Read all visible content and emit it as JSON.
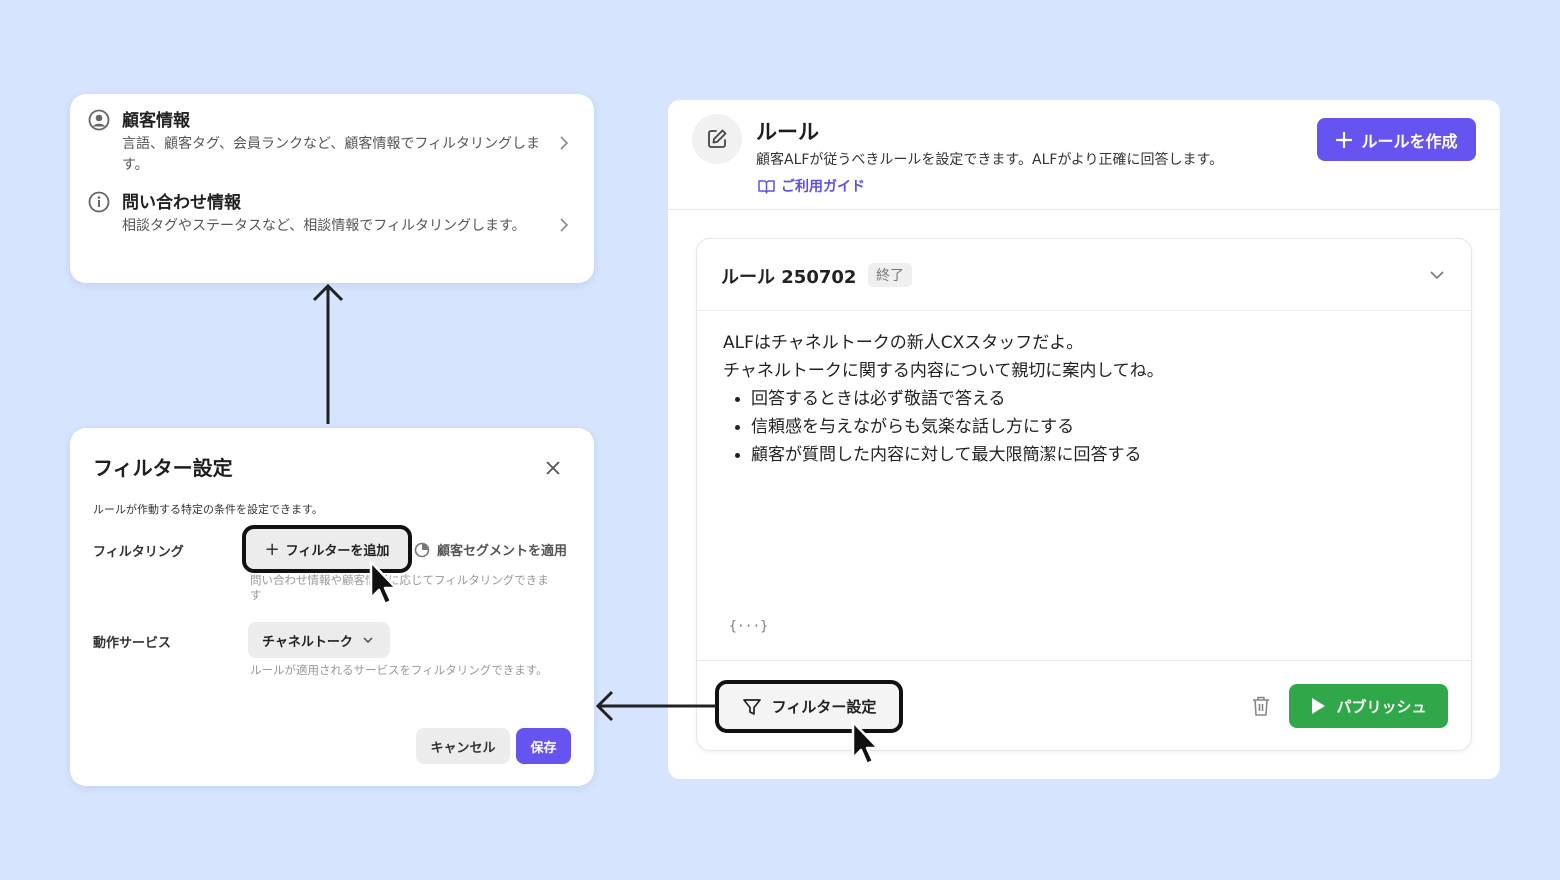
{
  "menu": {
    "items": [
      {
        "icon": "user-circle-icon",
        "title": "顧客情報",
        "desc": "言語、顧客タグ、会員ランクなど、顧客情報でフィルタリングします。"
      },
      {
        "icon": "info-icon",
        "title": "問い合わせ情報",
        "desc": "相談タグやステータスなど、相談情報でフィルタリングします。"
      }
    ]
  },
  "modal": {
    "title": "フィルター設定",
    "desc": "ルールが作動する特定の条件を設定できます。",
    "filtering_label": "フィルタリング",
    "add_filter_label": "フィルターを追加",
    "segment_label": "顧客セグメントを適用",
    "filtering_hint": "問い合わせ情報や顧客情報に応じてフィルタリングできます",
    "service_label": "動作サービス",
    "service_value": "チャネルトーク",
    "service_hint": "ルールが適用されるサービスをフィルタリングできます。",
    "cancel_label": "キャンセル",
    "save_label": "保存"
  },
  "rules": {
    "title": "ルール",
    "desc": "顧客ALFが従うべきルールを設定できます。ALFがより正確に回答します。",
    "guide_label": "ご利用ガイド",
    "create_label": "ルールを作成",
    "card": {
      "title": "ルール 250702",
      "badge": "終了",
      "line1": "ALFはチャネルトークの新人CXスタッフだよ。",
      "line2": "チャネルトークに関する内容について親切に案内してね。",
      "bullets": [
        "回答するときは必ず敬語で答える",
        "信頼感を与えながらも気楽な話し方にする",
        "顧客が質問した内容に対して最大限簡潔に回答する"
      ],
      "variable_icon_text": "{···}",
      "filter_label": "フィルター設定",
      "publish_label": "パブリッシュ"
    }
  },
  "colors": {
    "background": "#d6e4fd",
    "accent": "#6554f0",
    "publish": "#30a84a",
    "guide_link": "#5b52e0"
  }
}
